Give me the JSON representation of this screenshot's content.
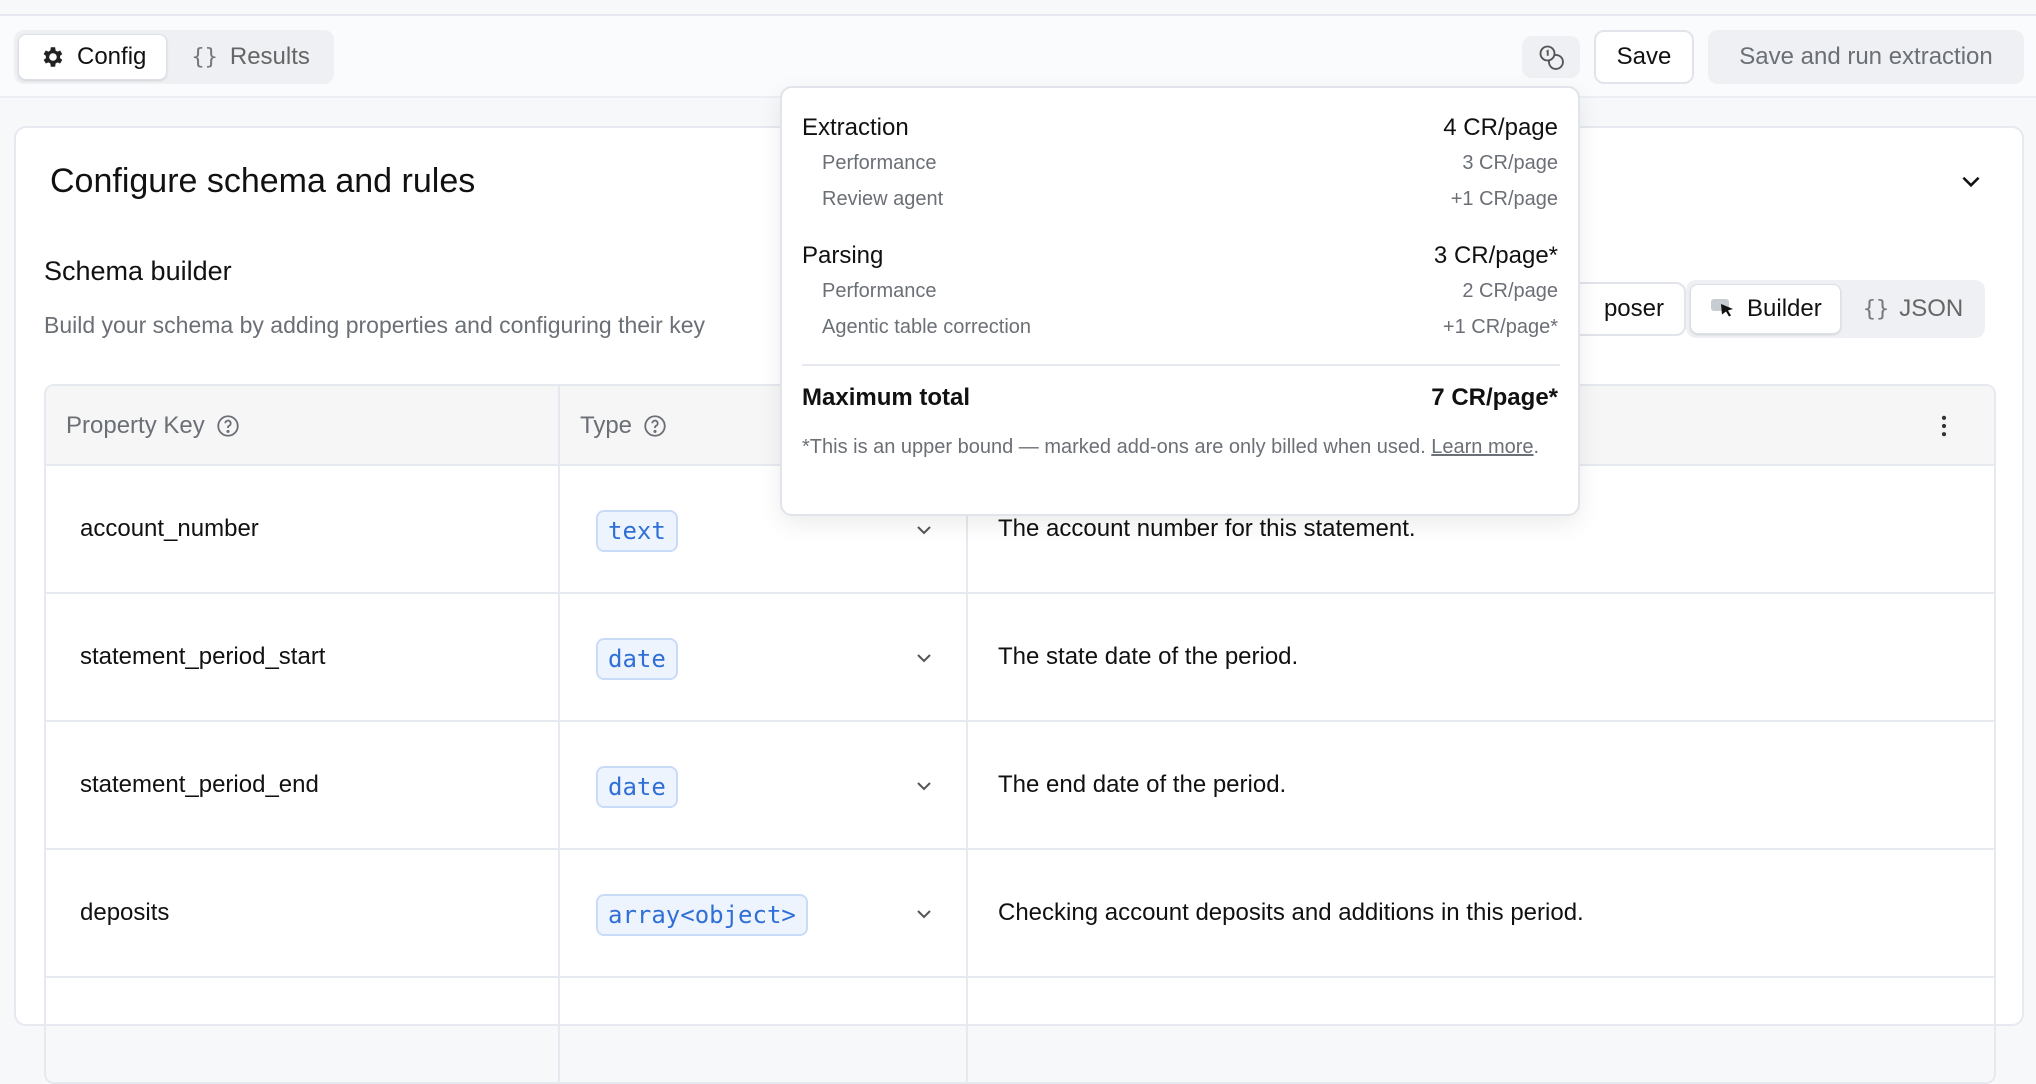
{
  "toolbar": {
    "tabs": [
      {
        "label": "Config",
        "icon": "gear-icon",
        "active": true
      },
      {
        "label": "Results",
        "icon": "braces-icon",
        "active": false
      }
    ],
    "credits_icon": "coins-icon",
    "save_label": "Save",
    "run_label": "Save and run extraction"
  },
  "card": {
    "title": "Configure schema and rules",
    "schema_title": "Schema builder",
    "schema_desc": "Build your schema by adding properties and configuring their key",
    "composer_label": "poser",
    "mode_tabs": [
      {
        "label": "Builder",
        "icon": "cursor-icon",
        "active": true
      },
      {
        "label": "JSON",
        "icon": "braces-icon",
        "active": false
      }
    ]
  },
  "table": {
    "headers": {
      "key": "Property Key",
      "type": "Type"
    },
    "rows": [
      {
        "key": "account_number",
        "type": "text",
        "description": "The account number for this statement."
      },
      {
        "key": "statement_period_start",
        "type": "date",
        "description": "The state date of the period."
      },
      {
        "key": "statement_period_end",
        "type": "date",
        "description": "The end date of the period."
      },
      {
        "key": "deposits",
        "type": "array<object>",
        "description": "Checking account deposits and additions in this period."
      }
    ]
  },
  "popover": {
    "extraction": {
      "label": "Extraction",
      "value": "4 CR/page"
    },
    "extraction_items": [
      {
        "label": "Performance",
        "value": "3 CR/page"
      },
      {
        "label": "Review agent",
        "value": "+1 CR/page"
      }
    ],
    "parsing": {
      "label": "Parsing",
      "value": "3 CR/page*"
    },
    "parsing_items": [
      {
        "label": "Performance",
        "value": "2 CR/page"
      },
      {
        "label": "Agentic table correction",
        "value": "+1 CR/page*"
      }
    ],
    "total": {
      "label": "Maximum total",
      "value": "7 CR/page*"
    },
    "note": "*This is an upper bound — marked add-ons are only billed when used.",
    "learn_more": "Learn more",
    "note_end": "."
  }
}
